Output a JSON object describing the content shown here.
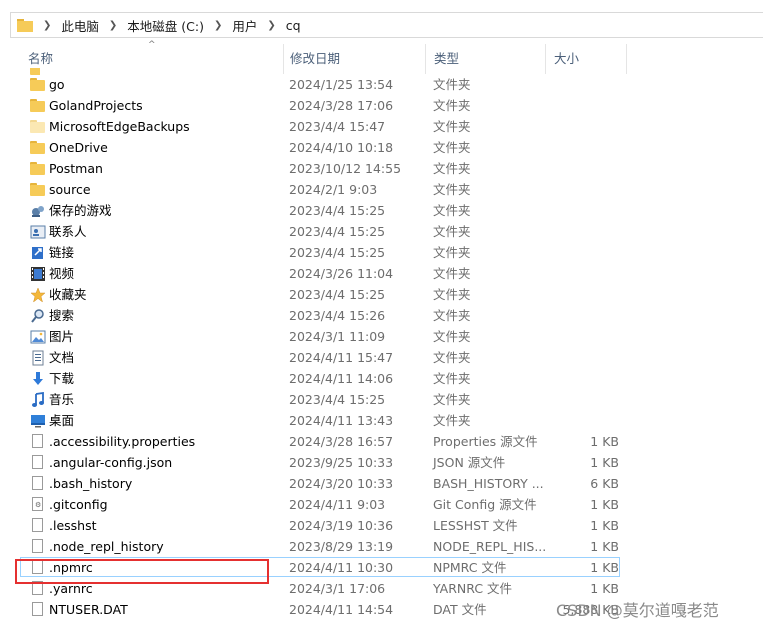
{
  "address": {
    "crumbs": [
      "此电脑",
      "本地磁盘 (C:)",
      "用户",
      "cq"
    ]
  },
  "columns": {
    "name": "名称",
    "date": "修改日期",
    "type": "类型",
    "size": "大小"
  },
  "rows": [
    {
      "name": "go",
      "date": "2024/1/25 13:54",
      "type": "文件夹",
      "size": "",
      "icon": "folder-icon"
    },
    {
      "name": "GolandProjects",
      "date": "2024/3/28 17:06",
      "type": "文件夹",
      "size": "",
      "icon": "folder-icon"
    },
    {
      "name": "MicrosoftEdgeBackups",
      "date": "2023/4/4 15:47",
      "type": "文件夹",
      "size": "",
      "icon": "folder-icon"
    },
    {
      "name": "OneDrive",
      "date": "2024/4/10 10:18",
      "type": "文件夹",
      "size": "",
      "icon": "folder-icon"
    },
    {
      "name": "Postman",
      "date": "2023/10/12 14:55",
      "type": "文件夹",
      "size": "",
      "icon": "folder-icon"
    },
    {
      "name": "source",
      "date": "2024/2/1 9:03",
      "type": "文件夹",
      "size": "",
      "icon": "folder-icon"
    },
    {
      "name": "保存的游戏",
      "date": "2023/4/4 15:25",
      "type": "文件夹",
      "size": "",
      "icon": "saved-games-icon"
    },
    {
      "name": "联系人",
      "date": "2023/4/4 15:25",
      "type": "文件夹",
      "size": "",
      "icon": "contacts-icon"
    },
    {
      "name": "链接",
      "date": "2023/4/4 15:25",
      "type": "文件夹",
      "size": "",
      "icon": "links-icon"
    },
    {
      "name": "视频",
      "date": "2024/3/26 11:04",
      "type": "文件夹",
      "size": "",
      "icon": "videos-icon"
    },
    {
      "name": "收藏夹",
      "date": "2023/4/4 15:25",
      "type": "文件夹",
      "size": "",
      "icon": "favorites-icon"
    },
    {
      "name": "搜索",
      "date": "2023/4/4 15:26",
      "type": "文件夹",
      "size": "",
      "icon": "searches-icon"
    },
    {
      "name": "图片",
      "date": "2024/3/1 11:09",
      "type": "文件夹",
      "size": "",
      "icon": "pictures-icon"
    },
    {
      "name": "文档",
      "date": "2024/4/11 15:47",
      "type": "文件夹",
      "size": "",
      "icon": "documents-icon"
    },
    {
      "name": "下载",
      "date": "2024/4/11 14:06",
      "type": "文件夹",
      "size": "",
      "icon": "downloads-icon"
    },
    {
      "name": "音乐",
      "date": "2023/4/4 15:25",
      "type": "文件夹",
      "size": "",
      "icon": "music-icon"
    },
    {
      "name": "桌面",
      "date": "2024/4/11 13:43",
      "type": "文件夹",
      "size": "",
      "icon": "desktop-icon"
    },
    {
      "name": ".accessibility.properties",
      "date": "2024/3/28 16:57",
      "type": "Properties 源文件",
      "size": "1 KB",
      "icon": "file-icon"
    },
    {
      "name": ".angular-config.json",
      "date": "2023/9/25 10:33",
      "type": "JSON 源文件",
      "size": "1 KB",
      "icon": "file-icon"
    },
    {
      "name": ".bash_history",
      "date": "2024/3/20 10:33",
      "type": "BASH_HISTORY ...",
      "size": "6 KB",
      "icon": "file-icon"
    },
    {
      "name": ".gitconfig",
      "date": "2024/4/11 9:03",
      "type": "Git Config 源文件",
      "size": "1 KB",
      "icon": "gear-file-icon"
    },
    {
      "name": ".lesshst",
      "date": "2024/3/19 10:36",
      "type": "LESSHST 文件",
      "size": "1 KB",
      "icon": "file-icon"
    },
    {
      "name": ".node_repl_history",
      "date": "2023/8/29 13:19",
      "type": "NODE_REPL_HIS...",
      "size": "1 KB",
      "icon": "file-icon"
    },
    {
      "name": ".npmrc",
      "date": "2024/4/11 10:30",
      "type": "NPMRC 文件",
      "size": "1 KB",
      "icon": "file-icon",
      "selected": true
    },
    {
      "name": ".yarnrc",
      "date": "2024/3/1 17:06",
      "type": "YARNRC 文件",
      "size": "1 KB",
      "icon": "file-icon"
    },
    {
      "name": "NTUSER.DAT",
      "date": "2024/4/11 14:54",
      "type": "DAT 文件",
      "size": "5,888 KB",
      "icon": "file-icon"
    }
  ],
  "watermark": "CSDN @莫尔道嘎老范"
}
